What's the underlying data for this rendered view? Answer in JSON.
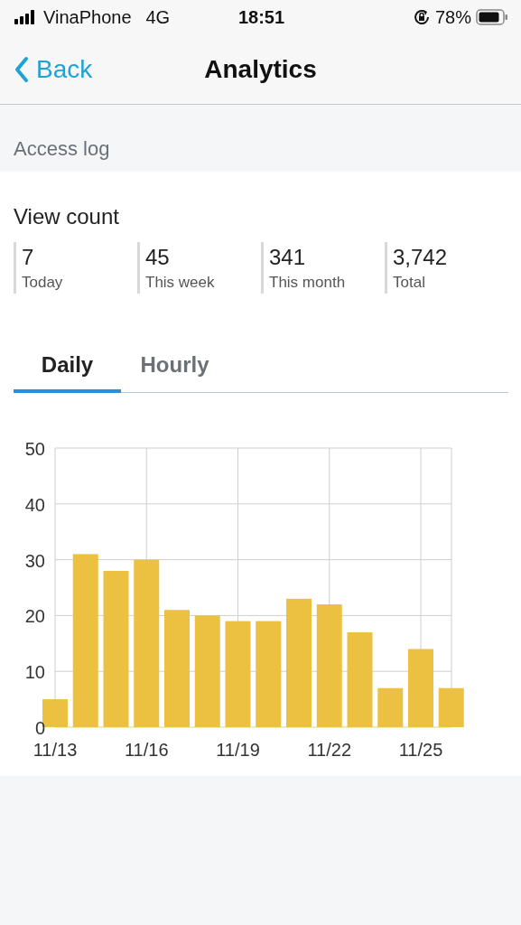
{
  "status_bar": {
    "carrier": "VinaPhone",
    "network": "4G",
    "time": "18:51",
    "battery": "78%"
  },
  "nav_bar": {
    "back": "Back",
    "title": "Analytics"
  },
  "section_header": "Access log",
  "view_count": {
    "title": "View count",
    "stats": [
      {
        "value": "7",
        "label": "Today"
      },
      {
        "value": "45",
        "label": "This week"
      },
      {
        "value": "341",
        "label": "This month"
      },
      {
        "value": "3,742",
        "label": "Total"
      }
    ],
    "tabs": [
      {
        "label": "Daily",
        "selected": true
      },
      {
        "label": "Hourly",
        "selected": false
      }
    ],
    "chart_data": {
      "type": "bar",
      "grid": true,
      "categories": [
        "11/13",
        null,
        null,
        "11/16",
        null,
        null,
        "11/19",
        null,
        null,
        "11/22",
        null,
        null,
        "11/25",
        null
      ],
      "series": [
        {
          "color": "#ecc142",
          "values": [
            5,
            31,
            28,
            30,
            21,
            20,
            19,
            19,
            23,
            22,
            17,
            7,
            14,
            7
          ]
        }
      ],
      "ylim": [
        0,
        50
      ],
      "yticks": [
        0,
        10,
        20,
        30,
        40,
        50
      ]
    }
  }
}
